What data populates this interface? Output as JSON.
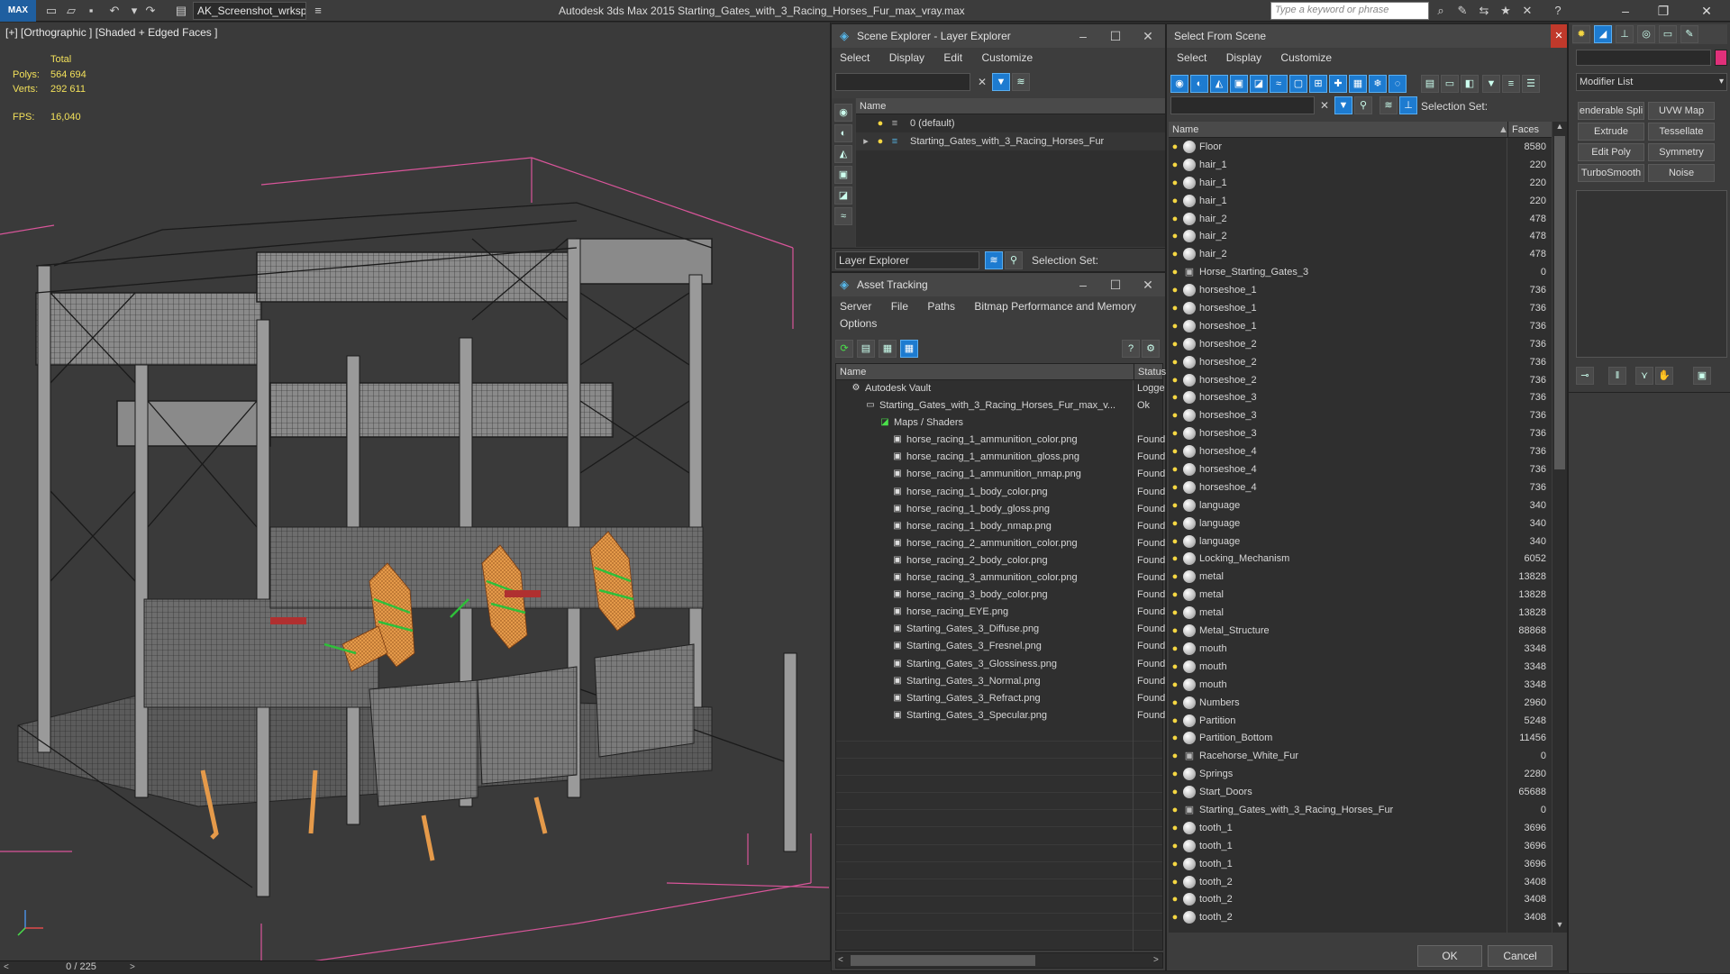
{
  "app": {
    "logo": "MAX",
    "workspace": "AK_Screenshot_wrksp",
    "title": "Autodesk 3ds Max  2015     Starting_Gates_with_3_Racing_Horses_Fur_max_vray.max",
    "search_placeholder": "Type a keyword or phrase"
  },
  "viewport": {
    "label": "[+] [Orthographic ] [Shaded + Edged Faces ]",
    "total_label": "Total",
    "polys_label": "Polys:",
    "polys_value": "564 694",
    "verts_label": "Verts:",
    "verts_value": "292 611",
    "fps_label": "FPS:",
    "fps_value": "16,040",
    "frame_counter": "0 / 225"
  },
  "scene_explorer": {
    "title": "Scene Explorer - Layer Explorer",
    "menu": [
      "Select",
      "Display",
      "Edit",
      "Customize"
    ],
    "col_name": "Name",
    "layers": [
      "0 (default)",
      "Starting_Gates_with_3_Racing_Horses_Fur"
    ],
    "footer_dropdown": "Layer Explorer",
    "selection_set_label": "Selection Set:"
  },
  "asset_tracking": {
    "title": "Asset Tracking",
    "menu": [
      "Server",
      "File",
      "Paths",
      "Bitmap Performance and Memory"
    ],
    "menu2": "Options",
    "col_name": "Name",
    "col_status": "Status",
    "rows": [
      {
        "name": "Autodesk Vault",
        "status": "Logge",
        "level": 1
      },
      {
        "name": "Starting_Gates_with_3_Racing_Horses_Fur_max_v...",
        "status": "Ok",
        "level": 2
      },
      {
        "name": "Maps / Shaders",
        "status": "",
        "level": 3
      },
      {
        "name": "horse_racing_1_ammunition_color.png",
        "status": "Found",
        "level": 4
      },
      {
        "name": "horse_racing_1_ammunition_gloss.png",
        "status": "Found",
        "level": 4
      },
      {
        "name": "horse_racing_1_ammunition_nmap.png",
        "status": "Found",
        "level": 4
      },
      {
        "name": "horse_racing_1_body_color.png",
        "status": "Found",
        "level": 4
      },
      {
        "name": "horse_racing_1_body_gloss.png",
        "status": "Found",
        "level": 4
      },
      {
        "name": "horse_racing_1_body_nmap.png",
        "status": "Found",
        "level": 4
      },
      {
        "name": "horse_racing_2_ammunition_color.png",
        "status": "Found",
        "level": 4
      },
      {
        "name": "horse_racing_2_body_color.png",
        "status": "Found",
        "level": 4
      },
      {
        "name": "horse_racing_3_ammunition_color.png",
        "status": "Found",
        "level": 4
      },
      {
        "name": "horse_racing_3_body_color.png",
        "status": "Found",
        "level": 4
      },
      {
        "name": "horse_racing_EYE.png",
        "status": "Found",
        "level": 4
      },
      {
        "name": "Starting_Gates_3_Diffuse.png",
        "status": "Found",
        "level": 4
      },
      {
        "name": "Starting_Gates_3_Fresnel.png",
        "status": "Found",
        "level": 4
      },
      {
        "name": "Starting_Gates_3_Glossiness.png",
        "status": "Found",
        "level": 4
      },
      {
        "name": "Starting_Gates_3_Normal.png",
        "status": "Found",
        "level": 4
      },
      {
        "name": "Starting_Gates_3_Refract.png",
        "status": "Found",
        "level": 4
      },
      {
        "name": "Starting_Gates_3_Specular.png",
        "status": "Found",
        "level": 4
      }
    ]
  },
  "select_from_scene": {
    "title": "Select From Scene",
    "menu": [
      "Select",
      "Display",
      "Customize"
    ],
    "selection_set_label": "Selection Set:",
    "col_name": "Name",
    "col_faces": "Faces",
    "ok": "OK",
    "cancel": "Cancel",
    "rows": [
      {
        "name": "Floor",
        "faces": "8580",
        "group": false
      },
      {
        "name": "hair_1",
        "faces": "220",
        "group": false
      },
      {
        "name": "hair_1",
        "faces": "220",
        "group": false
      },
      {
        "name": "hair_1",
        "faces": "220",
        "group": false
      },
      {
        "name": "hair_2",
        "faces": "478",
        "group": false
      },
      {
        "name": "hair_2",
        "faces": "478",
        "group": false
      },
      {
        "name": "hair_2",
        "faces": "478",
        "group": false
      },
      {
        "name": "Horse_Starting_Gates_3",
        "faces": "0",
        "group": true
      },
      {
        "name": "horseshoe_1",
        "faces": "736",
        "group": false
      },
      {
        "name": "horseshoe_1",
        "faces": "736",
        "group": false
      },
      {
        "name": "horseshoe_1",
        "faces": "736",
        "group": false
      },
      {
        "name": "horseshoe_2",
        "faces": "736",
        "group": false
      },
      {
        "name": "horseshoe_2",
        "faces": "736",
        "group": false
      },
      {
        "name": "horseshoe_2",
        "faces": "736",
        "group": false
      },
      {
        "name": "horseshoe_3",
        "faces": "736",
        "group": false
      },
      {
        "name": "horseshoe_3",
        "faces": "736",
        "group": false
      },
      {
        "name": "horseshoe_3",
        "faces": "736",
        "group": false
      },
      {
        "name": "horseshoe_4",
        "faces": "736",
        "group": false
      },
      {
        "name": "horseshoe_4",
        "faces": "736",
        "group": false
      },
      {
        "name": "horseshoe_4",
        "faces": "736",
        "group": false
      },
      {
        "name": "language",
        "faces": "340",
        "group": false
      },
      {
        "name": "language",
        "faces": "340",
        "group": false
      },
      {
        "name": "language",
        "faces": "340",
        "group": false
      },
      {
        "name": "Locking_Mechanism",
        "faces": "6052",
        "group": false
      },
      {
        "name": "metal",
        "faces": "13828",
        "group": false
      },
      {
        "name": "metal",
        "faces": "13828",
        "group": false
      },
      {
        "name": "metal",
        "faces": "13828",
        "group": false
      },
      {
        "name": "Metal_Structure",
        "faces": "88868",
        "group": false
      },
      {
        "name": "mouth",
        "faces": "3348",
        "group": false
      },
      {
        "name": "mouth",
        "faces": "3348",
        "group": false
      },
      {
        "name": "mouth",
        "faces": "3348",
        "group": false
      },
      {
        "name": "Numbers",
        "faces": "2960",
        "group": false
      },
      {
        "name": "Partition",
        "faces": "5248",
        "group": false
      },
      {
        "name": "Partition_Bottom",
        "faces": "11456",
        "group": false
      },
      {
        "name": "Racehorse_White_Fur",
        "faces": "0",
        "group": true
      },
      {
        "name": "Springs",
        "faces": "2280",
        "group": false
      },
      {
        "name": "Start_Doors",
        "faces": "65688",
        "group": false
      },
      {
        "name": "Starting_Gates_with_3_Racing_Horses_Fur",
        "faces": "0",
        "group": true
      },
      {
        "name": "tooth_1",
        "faces": "3696",
        "group": false
      },
      {
        "name": "tooth_1",
        "faces": "3696",
        "group": false
      },
      {
        "name": "tooth_1",
        "faces": "3696",
        "group": false
      },
      {
        "name": "tooth_2",
        "faces": "3408",
        "group": false
      },
      {
        "name": "tooth_2",
        "faces": "3408",
        "group": false
      },
      {
        "name": "tooth_2",
        "faces": "3408",
        "group": false
      }
    ]
  },
  "command_panel": {
    "modifier_list": "Modifier List",
    "buttons": [
      "enderable Spli",
      "UVW Map",
      "Extrude",
      "Tessellate",
      "Edit Poly",
      "Symmetry",
      "TurboSmooth",
      "Noise"
    ]
  },
  "colors": {
    "accent": "#1d7bd0",
    "bulb": "#f5d742",
    "stats": "#f2e05a",
    "horse": "#e59a4a",
    "bridle": "#2fbf3a",
    "pink_lines": "#d9559a"
  }
}
